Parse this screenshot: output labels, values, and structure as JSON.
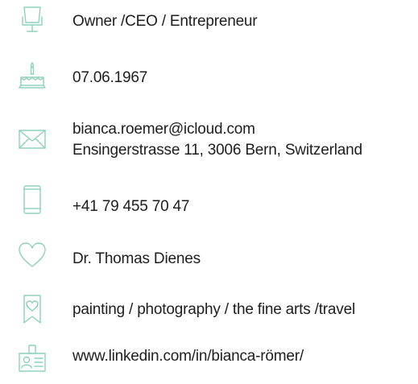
{
  "profile": {
    "occupation": {
      "icon": "office-chair-icon",
      "text": "Owner /CEO / Entrepreneur"
    },
    "birthday": {
      "icon": "birthday-cake-icon",
      "text": "07.06.1967"
    },
    "contact": {
      "icon": "envelope-icon",
      "email": "bianca.roemer@icloud.com",
      "address": "Ensingerstrasse 11, 3006 Bern, Switzerland"
    },
    "phone": {
      "icon": "mobile-phone-icon",
      "text": "+41 79 455 70 47"
    },
    "partner": {
      "icon": "heart-icon",
      "text": "Dr. Thomas Dienes"
    },
    "interests": {
      "icon": "bookmark-heart-icon",
      "text": "painting / photography / the fine arts /travel"
    },
    "linkedin": {
      "icon": "id-badge-icon",
      "text": "www.linkedin.com/in/bianca-römer/"
    }
  },
  "colors": {
    "icon_stroke": "#8fd1bd",
    "text": "#1e1e1e",
    "background": "#ffffff"
  }
}
